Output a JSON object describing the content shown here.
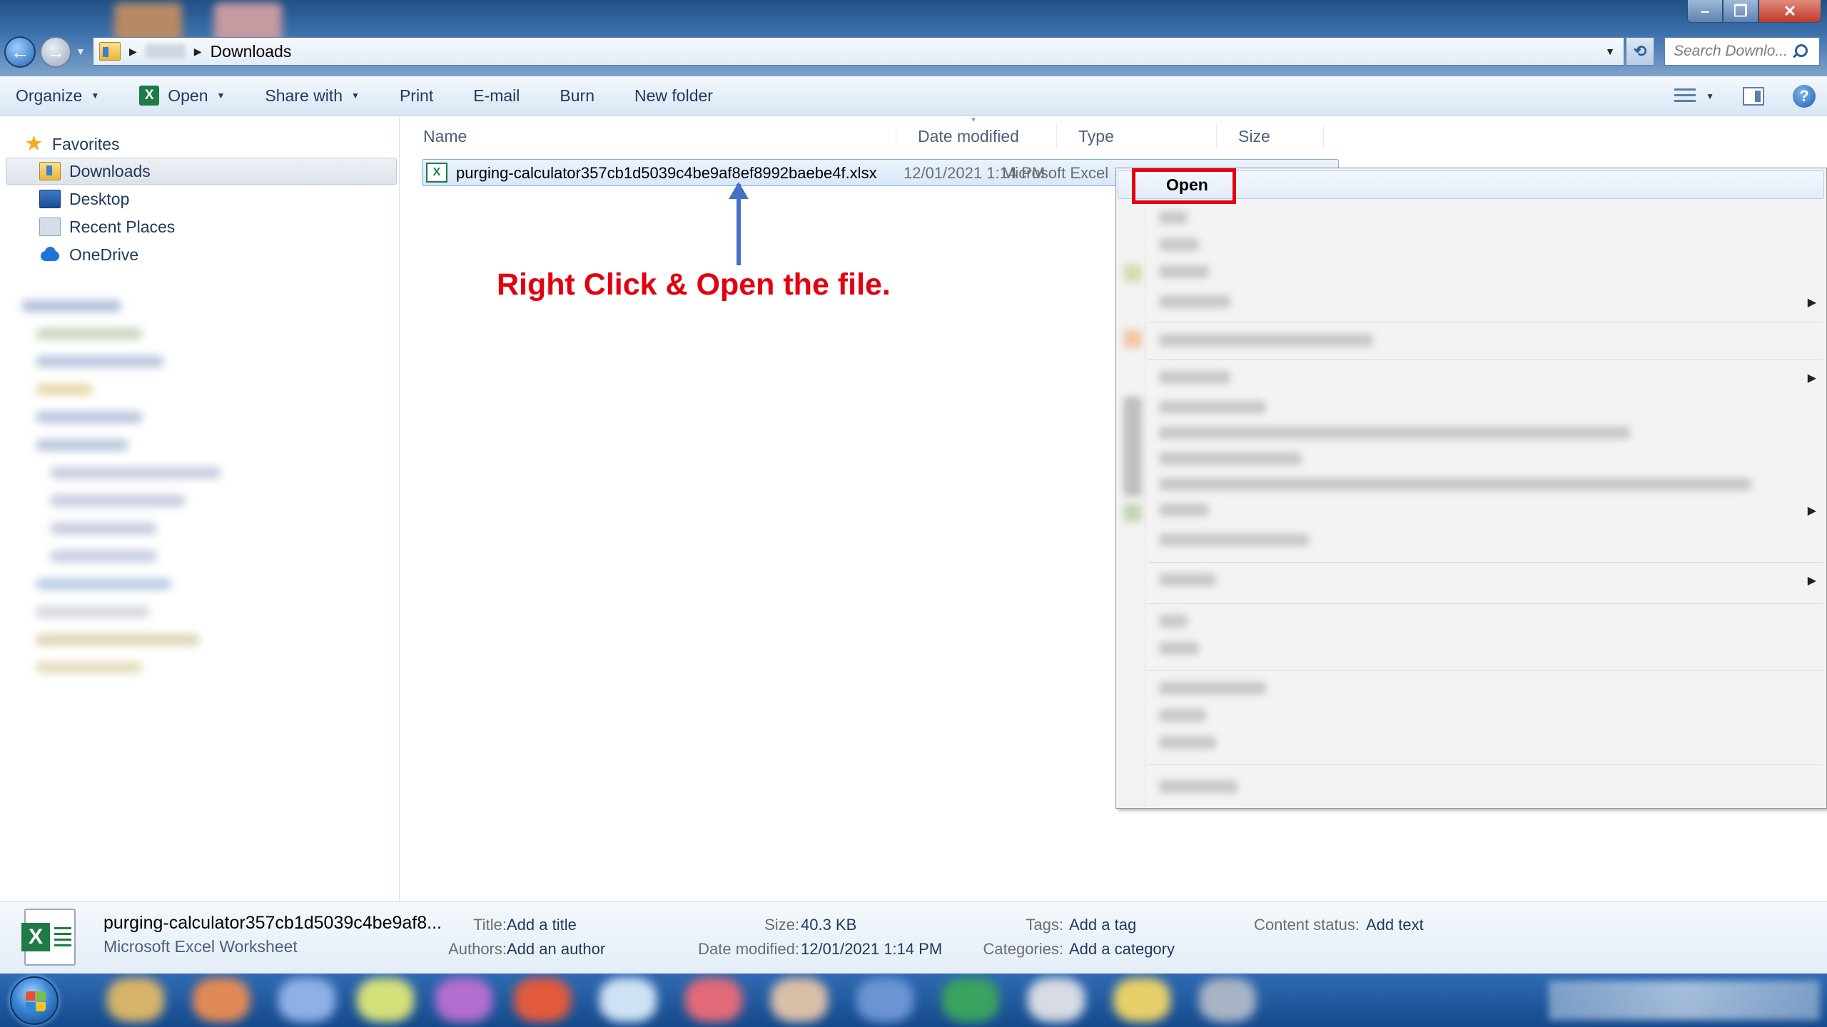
{
  "window": {
    "controls": [
      "minimize",
      "restore",
      "close"
    ],
    "control_glyphs": {
      "minimize": "–",
      "restore": "❐",
      "close": "✕"
    }
  },
  "address": {
    "current_folder": "Downloads",
    "search_placeholder": "Search Downlo..."
  },
  "toolbar": {
    "organize": "Organize",
    "open": "Open",
    "share_with": "Share with",
    "print": "Print",
    "email": "E-mail",
    "burn": "Burn",
    "new_folder": "New folder"
  },
  "sidebar": {
    "favorites_label": "Favorites",
    "items": [
      {
        "label": "Downloads",
        "icon": "downloads-folder-icon",
        "selected": true
      },
      {
        "label": "Desktop",
        "icon": "desktop-icon",
        "selected": false
      },
      {
        "label": "Recent Places",
        "icon": "recent-places-icon",
        "selected": false
      },
      {
        "label": "OneDrive",
        "icon": "onedrive-icon",
        "selected": false
      }
    ]
  },
  "filelist": {
    "columns": [
      "Name",
      "Date modified",
      "Type",
      "Size"
    ],
    "rows": [
      {
        "name": "purging-calculator357cb1d5039c4be9af8ef8992baebe4f.xlsx",
        "date_modified": "12/01/2021 1:14 PM",
        "type": "Microsoft Excel",
        "icon": "excel-file-icon"
      }
    ]
  },
  "annotation": {
    "text": "Right Click & Open the file.",
    "color": "#e3000f",
    "arrow_color": "#4472c4"
  },
  "context_menu": {
    "first_item": "Open",
    "highlight_color": "#e3000f"
  },
  "details": {
    "file_name": "purging-calculator357cb1d5039c4be9af8...",
    "file_type": "Microsoft Excel Worksheet",
    "title_label": "Title:",
    "title_value": "Add a title",
    "authors_label": "Authors:",
    "authors_value": "Add an author",
    "size_label": "Size:",
    "size_value": "40.3 KB",
    "date_label": "Date modified:",
    "date_value": "12/01/2021 1:14 PM",
    "tags_label": "Tags:",
    "tags_value": "Add a tag",
    "categories_label": "Categories:",
    "categories_value": "Add a category",
    "content_status_label": "Content status:",
    "content_status_value": "Add text"
  },
  "colors": {
    "titlebar": "#3e72ad",
    "toolbar": "#e4eef8",
    "selection": "#d8e8fb",
    "excel_green": "#1e7b45"
  }
}
